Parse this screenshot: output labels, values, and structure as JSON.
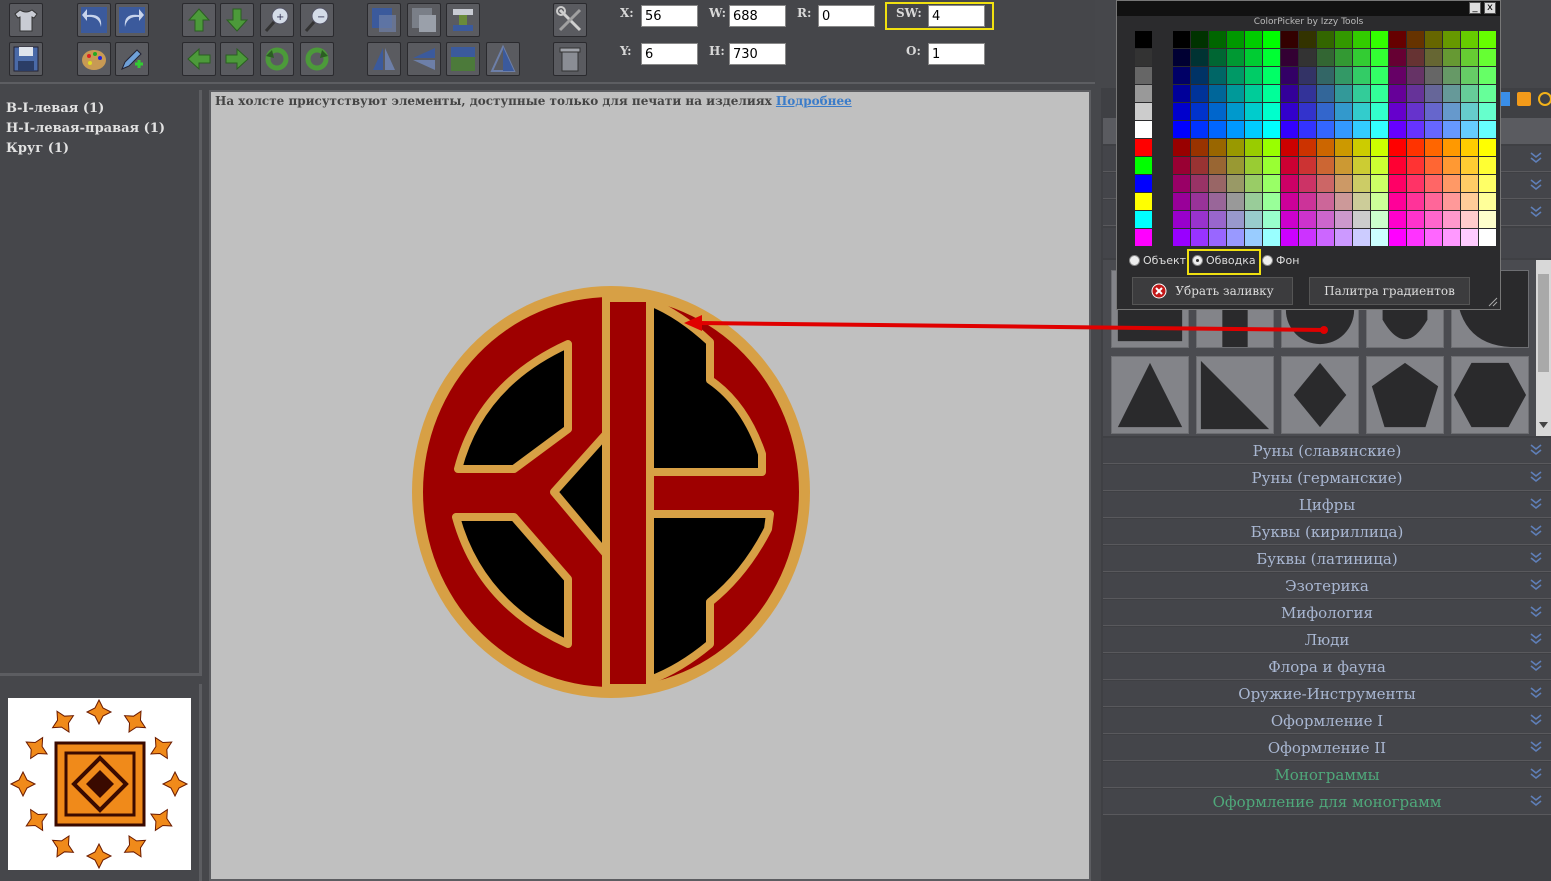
{
  "toolbar": {
    "fields": {
      "x": {
        "label": "X:",
        "value": "56"
      },
      "y": {
        "label": "Y:",
        "value": "6"
      },
      "w": {
        "label": "W:",
        "value": "688"
      },
      "h": {
        "label": "H:",
        "value": "730"
      },
      "r": {
        "label": "R:",
        "value": "0"
      },
      "sw": {
        "label": "SW:",
        "value": "4"
      },
      "o": {
        "label": "O:",
        "value": "1"
      }
    }
  },
  "layers": {
    "items": [
      {
        "label": "В-І-левая (1)"
      },
      {
        "label": "Н-І-левая-правая (1)"
      },
      {
        "label": "Круг (1)"
      }
    ]
  },
  "canvas": {
    "notice_text": "На холсте присутствуют элементы, доступные только для печати на изделиях",
    "notice_link": "Подробнее",
    "logo_colors": {
      "ring": "#d7a045",
      "fill": "#9e0000",
      "inner": "#000000"
    }
  },
  "colorpicker": {
    "title": "ColorPicker by Izzy Tools",
    "minimize": "_",
    "close": "x",
    "radio_object": "Объект",
    "radio_stroke": "Обводка",
    "radio_background": "Фон",
    "btn_remove_fill": "Убрать заливку",
    "btn_gradients": "Палитра градиентов"
  },
  "categories": [
    {
      "label": "Руны (славянские)",
      "style": "blue"
    },
    {
      "label": "Руны (германские)",
      "style": "blue"
    },
    {
      "label": "Цифры",
      "style": "blue"
    },
    {
      "label": "Буквы (кириллица)",
      "style": "blue"
    },
    {
      "label": "Буквы (латиница)",
      "style": "blue"
    },
    {
      "label": "Эзотерика",
      "style": "blue"
    },
    {
      "label": "Мифология",
      "style": "blue"
    },
    {
      "label": "Люди",
      "style": "blue"
    },
    {
      "label": "Флора и фауна",
      "style": "blue"
    },
    {
      "label": "Оружие-Инструменты",
      "style": "blue"
    },
    {
      "label": "Оформление I",
      "style": "blue"
    },
    {
      "label": "Оформление II",
      "style": "blue"
    },
    {
      "label": "Монограммы",
      "style": "green"
    },
    {
      "label": "Оформление для монограмм",
      "style": "green"
    }
  ],
  "colors": {
    "highlight": "#f0e010",
    "arrow": "#e00000"
  }
}
